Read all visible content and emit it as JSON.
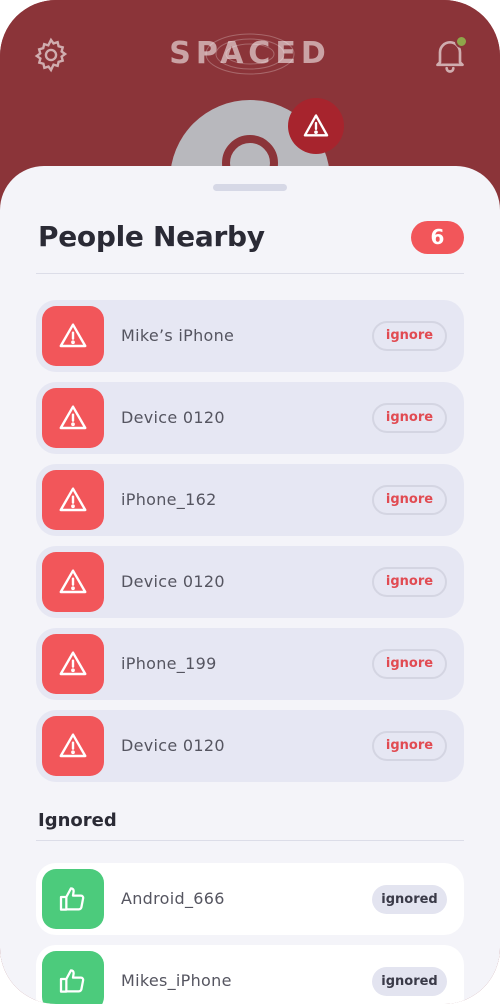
{
  "header": {
    "logo_text": "SPACED",
    "settings_icon": "gear-icon",
    "notifications_icon": "bell-icon",
    "alert_icon": "warning-triangle-icon"
  },
  "sheet": {
    "title": "People Nearby",
    "count": "6",
    "nearby_devices": [
      {
        "name": "Mike’s iPhone",
        "action": "ignore"
      },
      {
        "name": "Device 0120",
        "action": "ignore"
      },
      {
        "name": "iPhone_162",
        "action": "ignore"
      },
      {
        "name": "Device 0120",
        "action": "ignore"
      },
      {
        "name": "iPhone_199",
        "action": "ignore"
      },
      {
        "name": "Device 0120",
        "action": "ignore"
      }
    ],
    "ignored_label": "Ignored",
    "ignored_devices": [
      {
        "name": "Android_666",
        "status": "ignored"
      },
      {
        "name": "Mikes_iPhone",
        "status": "ignored"
      }
    ]
  },
  "colors": {
    "header_bg": "#8b3439",
    "alert_red": "#f2565a",
    "safe_green": "#4ccb7c",
    "sheet_bg": "#f4f4f9"
  }
}
